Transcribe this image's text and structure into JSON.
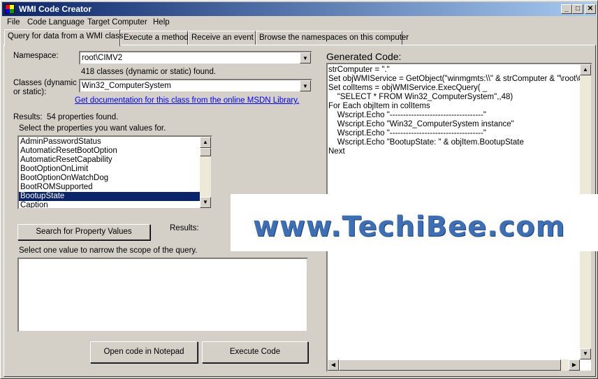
{
  "window": {
    "title": "WMI Code Creator",
    "buttons": {
      "minimize": "_",
      "maximize": "□",
      "close": "✕"
    }
  },
  "menu": [
    "File",
    "Code Language",
    "Target Computer",
    "Help"
  ],
  "tabs": [
    "Query for data from a WMI class",
    "Execute a method",
    "Receive an event",
    "Browse the namespaces on this computer"
  ],
  "query": {
    "namespace_label": "Namespace:",
    "namespace_value": "root\\CIMV2",
    "classes_found": "418 classes (dynamic or static) found.",
    "classes_label_1": "Classes (dynamic",
    "classes_label_2": "or static):",
    "class_value": "Win32_ComputerSystem",
    "doc_link": "Get documentation for this class from the online MSDN Library.",
    "results_label": "Results:",
    "results_count": "54 properties found.",
    "select_properties": "Select the properties you want values for.",
    "properties": [
      "AdminPasswordStatus",
      "AutomaticResetBootOption",
      "AutomaticResetCapability",
      "BootOptionOnLimit",
      "BootOptionOnWatchDog",
      "BootROMSupported",
      "BootupState",
      "Caption"
    ],
    "selected_property_index": 6,
    "search_button": "Search for Property Values",
    "search_results_label": "Results:",
    "narrow_label": "Select one value to narrow the scope of the query.",
    "open_notepad_button": "Open code in Notepad",
    "execute_button": "Execute Code"
  },
  "code": {
    "label": "Generated Code:",
    "lines": [
      "strComputer = \".\"",
      "Set objWMIService = GetObject(\"winmgmts:\\\\\" & strComputer & \"\\root\\CIMV",
      "Set colItems = objWMIService.ExecQuery( _",
      "    \"SELECT * FROM Win32_ComputerSystem\",,48)",
      "For Each objItem in colItems",
      "    Wscript.Echo \"-----------------------------------\"",
      "    Wscript.Echo \"Win32_ComputerSystem instance\"",
      "    Wscript.Echo \"-----------------------------------\"",
      "    Wscript.Echo \"BootupState: \" & objItem.BootupState",
      "Next"
    ]
  },
  "watermark": "www.TechiBee.com",
  "colors": {
    "titlebar": "#0a246a",
    "selection": "#0a246a",
    "link": "#0000ff",
    "watermark": "#3d6fb6"
  },
  "icons": [
    "app-icon",
    "minimize-icon",
    "maximize-icon",
    "close-icon",
    "dropdown-arrow-icon",
    "scroll-up-icon",
    "scroll-down-icon",
    "scroll-left-icon",
    "scroll-right-icon"
  ]
}
